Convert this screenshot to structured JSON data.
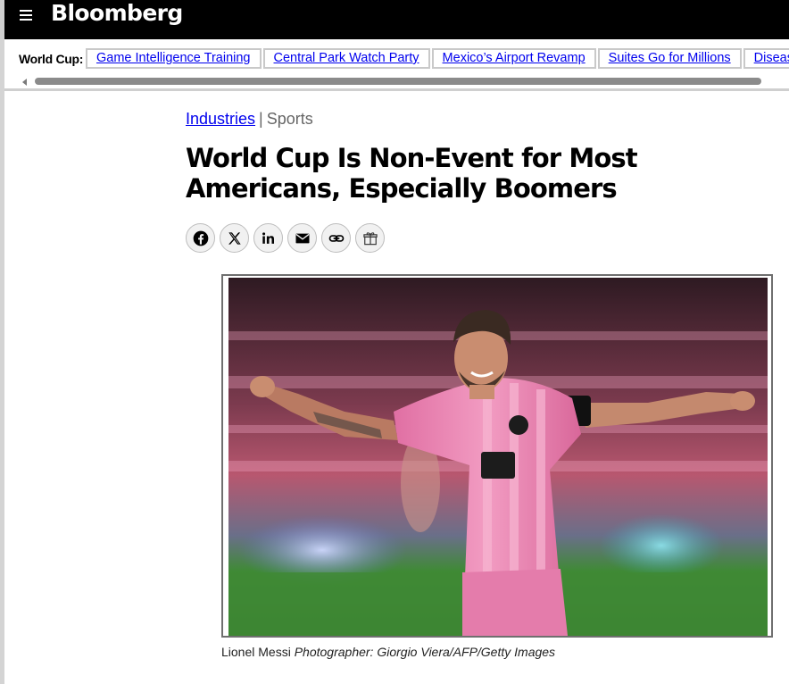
{
  "header": {
    "logo": "Bloomberg",
    "menu_icon": "hamburger-menu-icon"
  },
  "world_cup_strip": {
    "label": "World Cup:",
    "links": [
      "Game Intelligence Training",
      "Central Park Watch Party",
      "Mexico’s Airport Revamp",
      "Suites Go for Millions",
      "Disease"
    ]
  },
  "article": {
    "breadcrumb": {
      "primary": "Industries",
      "separator": "|",
      "secondary": "Sports"
    },
    "headline": "World Cup Is Non-Event for Most Americans, Especially Boomers",
    "share_icons": [
      "facebook-icon",
      "x-icon",
      "linkedin-icon",
      "email-icon",
      "link-icon",
      "gift-icon"
    ],
    "image": {
      "subject": "player in pink jersey celebrating with outstretched arms",
      "colors": {
        "jersey": "#e889b4",
        "pitch": "#3f8a35",
        "crowd": "#b8576f"
      }
    },
    "caption": {
      "name": "Lionel Messi",
      "credit": "Photographer: Giorgio Viera/AFP/Getty Images"
    }
  }
}
